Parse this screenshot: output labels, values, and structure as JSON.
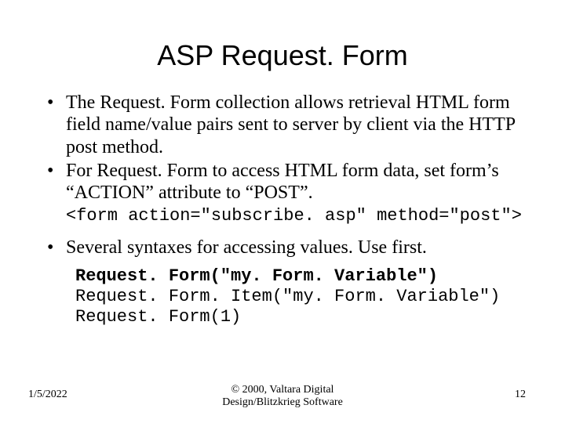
{
  "title": "ASP Request. Form",
  "bullets": {
    "b1": "The Request. Form collection allows retrieval HTML form field name/value pairs sent to server by client via the HTTP post method.",
    "b2": "For Request. Form to access HTML form data, set form’s “ACTION” attribute to “POST”.",
    "b3": "Several syntaxes for accessing values. Use first."
  },
  "code": {
    "formTag": "<form action=\"subscribe. asp\" method=\"post\">",
    "s1": "Request. Form(\"my. Form. Variable\")",
    "s2": "Request. Form. Item(\"my. Form. Variable\")",
    "s3": "Request. Form(1)"
  },
  "footer": {
    "date": "1/5/2022",
    "copyright_line1": "© 2000, Valtara Digital",
    "copyright_line2": "Design/Blitzkrieg Software",
    "page": "12"
  }
}
